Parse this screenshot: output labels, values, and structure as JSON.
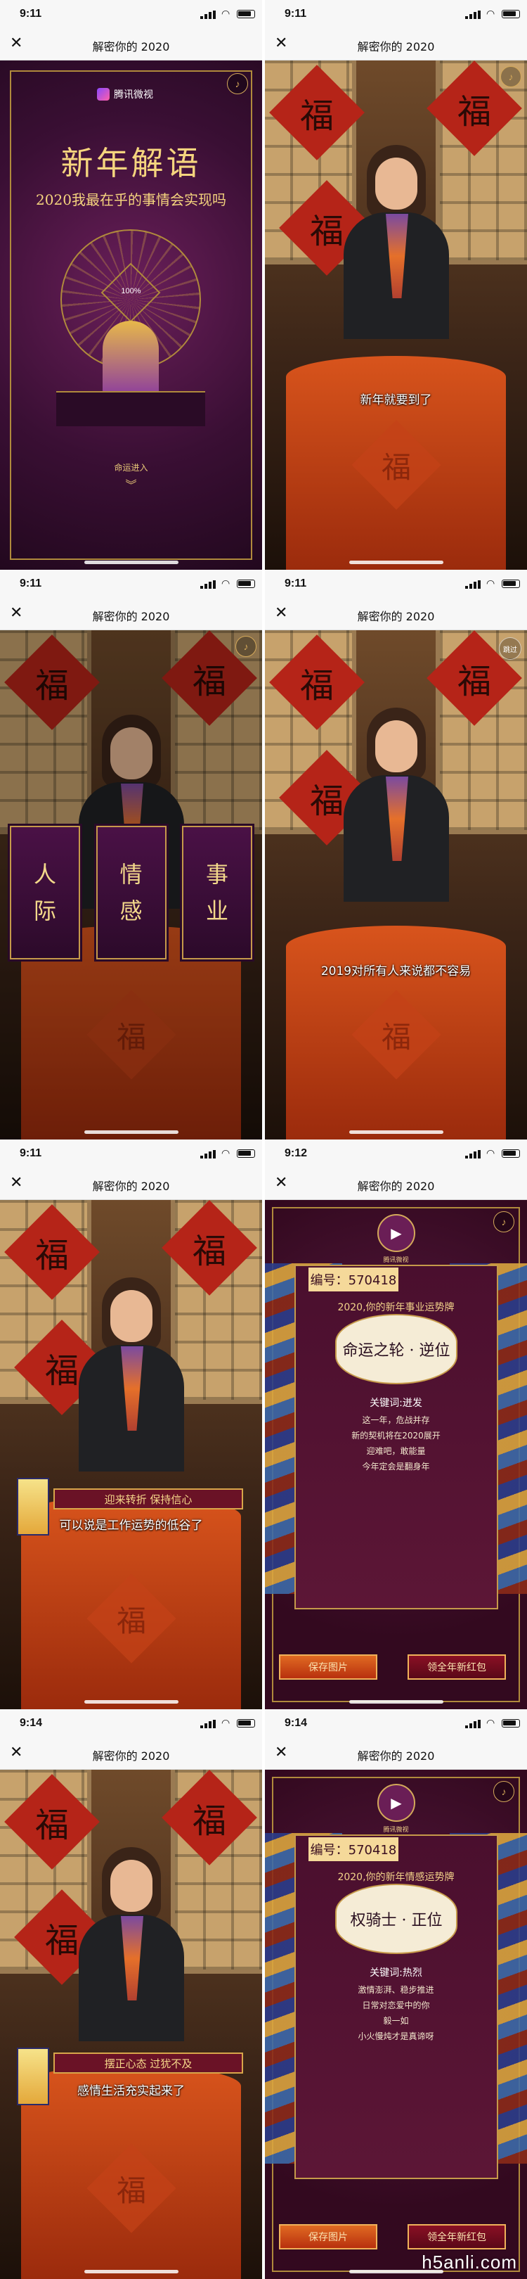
{
  "nav_title": "解密你的 2020",
  "screens": [
    {
      "time": "9:11",
      "type": "splash"
    },
    {
      "time": "9:11",
      "type": "video",
      "caption": "新年就要到了"
    },
    {
      "time": "9:11",
      "type": "categories"
    },
    {
      "time": "9:11",
      "type": "video",
      "caption": "2019对所有人来说都不容易",
      "skip": "跳过"
    },
    {
      "time": "9:11",
      "type": "video",
      "caption": "可以说是工作运势的低谷了",
      "banner": "迎来转折 保持信心"
    },
    {
      "time": "9:12",
      "type": "result"
    },
    {
      "time": "9:14",
      "type": "video",
      "caption": "感情生活充实起来了",
      "banner": "摆正心态 过犹不及"
    },
    {
      "time": "9:14",
      "type": "result"
    }
  ],
  "splash": {
    "logo": "腾讯微视",
    "title": "新年解语",
    "subtitle": "2020我最在乎的事情会实现吗",
    "percent": "100%",
    "enter": "命运进入"
  },
  "categories": [
    "人际",
    "情感",
    "事业"
  ],
  "skip_label": "跳过",
  "fu_char": "福",
  "result_career": {
    "top_label": "腾讯微视",
    "code": "编号：570418",
    "year": "2020,你的新年事业运势牌",
    "card": "命运之轮 · 逆位",
    "keyword": "关键词:迸发",
    "lines": [
      "这一年，危战并存",
      "新的契机将在2020展开",
      "迎难吧，敢能量",
      "今年定会是翻身年"
    ],
    "save": "保存图片",
    "redpack": "领全年新红包"
  },
  "result_love": {
    "top_label": "腾讯微视",
    "code": "编号：570418",
    "year": "2020,你的新年情感运势牌",
    "card": "权骑士 · 正位",
    "keyword": "关键词:热烈",
    "lines": [
      "激情澎湃、稳步推进",
      "日常对恋爱中的你",
      "毅一如",
      "小火慢炖才是真谛呀"
    ],
    "save": "保存图片",
    "redpack": "领全年新红包"
  },
  "watermark": "h5anli.com"
}
